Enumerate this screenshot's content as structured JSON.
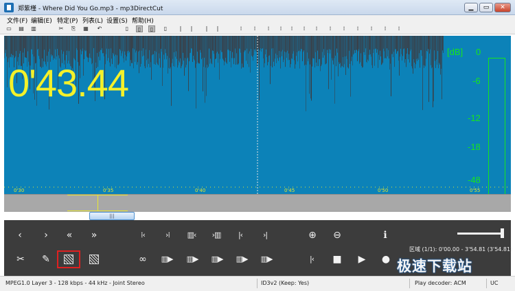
{
  "window": {
    "title": "郑紫槿 - Where Did You Go.mp3 - mp3DirectCut",
    "controls": [
      "▁",
      "▭",
      "✕"
    ]
  },
  "menu": [
    "文件(F)",
    "编辑(E)",
    "特定(P)",
    "列表(L)",
    "设置(S)",
    "帮助(H)"
  ],
  "toolbar": [
    {
      "icon": "open-icon",
      "glyph": "▭"
    },
    {
      "icon": "save-icon",
      "glyph": "▤"
    },
    {
      "icon": "save-all-icon",
      "glyph": "▥"
    },
    {
      "icon": "cut-icon",
      "glyph": "✂"
    },
    {
      "icon": "copy-icon",
      "glyph": "⎘"
    },
    {
      "icon": "paste-icon",
      "glyph": "▦"
    },
    {
      "icon": "undo-icon",
      "glyph": "↶"
    },
    {
      "icon": "doc-icon",
      "glyph": "▯"
    },
    {
      "icon": "doc-page-icon",
      "glyph": "▯"
    },
    {
      "icon": "doc-view-icon",
      "glyph": "▯"
    },
    {
      "icon": "doc-edit-icon",
      "glyph": "▯"
    },
    {
      "icon": "column-a-icon",
      "glyph": "|"
    },
    {
      "icon": "column-b-icon",
      "glyph": "|"
    },
    {
      "icon": "column-c-icon",
      "glyph": "|"
    },
    {
      "icon": "column-d-icon",
      "glyph": "|"
    },
    {
      "icon": "marker-a-icon",
      "glyph": "⁞"
    },
    {
      "icon": "marker-b-icon",
      "glyph": "⁞"
    },
    {
      "icon": "marker-c-icon",
      "glyph": "⁞"
    },
    {
      "icon": "marker-d-icon",
      "glyph": "⁞"
    },
    {
      "icon": "marker-e-icon",
      "glyph": "⁞"
    },
    {
      "icon": "marker-f-icon",
      "glyph": "⁞"
    },
    {
      "icon": "marker-g-icon",
      "glyph": "⁞"
    },
    {
      "icon": "marker-h-icon",
      "glyph": "⁞"
    },
    {
      "icon": "level-a-icon",
      "glyph": "⁞"
    },
    {
      "icon": "level-b-icon",
      "glyph": "⁞"
    },
    {
      "icon": "level-c-icon",
      "glyph": "⁞"
    },
    {
      "icon": "level-d-icon",
      "glyph": "⁞"
    },
    {
      "icon": "level-e-icon",
      "glyph": "⁞"
    }
  ],
  "waveform": {
    "time": "0'43.44",
    "db_unit": "[dB]",
    "db_scale": [
      "0",
      "-6",
      "-12",
      "-18",
      "-48"
    ],
    "ticks": [
      "0'30",
      "0'35",
      "0'40",
      "0'45",
      "0'50",
      "0'55"
    ],
    "colors": {
      "background": "#0c82b8",
      "wave": "#3a3f47",
      "time": "#f4f12a",
      "meter": "#17e61b"
    }
  },
  "scrollbar": {
    "thumb_label": "|||"
  },
  "controls": {
    "row1": [
      {
        "icon": "prev-icon",
        "glyph": "‹"
      },
      {
        "icon": "next-icon",
        "glyph": "›"
      },
      {
        "icon": "rewind-icon",
        "glyph": "«"
      },
      {
        "icon": "fast-forward-icon",
        "glyph": "»"
      },
      {
        "icon": "go-sel-start-icon",
        "glyph": "⁞‹"
      },
      {
        "icon": "go-sel-end-icon",
        "glyph": "›⁞"
      },
      {
        "icon": "sel-start-left-icon",
        "glyph": "▥‹"
      },
      {
        "icon": "sel-end-right-icon",
        "glyph": "›▥"
      },
      {
        "icon": "goto-start-icon",
        "glyph": "|‹"
      },
      {
        "icon": "goto-end-icon",
        "glyph": "›|"
      },
      {
        "icon": "zoom-in-icon",
        "glyph": "⊕"
      },
      {
        "icon": "zoom-out-icon",
        "glyph": "⊖"
      },
      {
        "icon": "info-icon",
        "glyph": "ℹ"
      }
    ],
    "row2": [
      {
        "icon": "scissors-icon",
        "glyph": "✂"
      },
      {
        "icon": "pencil-icon",
        "glyph": "✎"
      },
      {
        "icon": "select-icon",
        "glyph": ""
      },
      {
        "icon": "select-all-icon",
        "glyph": ""
      },
      {
        "icon": "loop-icon",
        "glyph": "∞"
      },
      {
        "icon": "play-selection-icon",
        "glyph": "▥▶"
      },
      {
        "icon": "play-sel-region-icon",
        "glyph": "▥▶"
      },
      {
        "icon": "play-from-start-icon",
        "glyph": "▥▶"
      },
      {
        "icon": "play-to-end-icon",
        "glyph": "▥▶"
      },
      {
        "icon": "play-last-icon",
        "glyph": "▥▶"
      },
      {
        "icon": "go-start-icon",
        "glyph": "|‹"
      },
      {
        "icon": "stop-icon",
        "glyph": "■"
      },
      {
        "icon": "play-icon",
        "glyph": "▶"
      },
      {
        "icon": "record-icon",
        "glyph": "●"
      }
    ],
    "region": "区域 (1/1): 0'00.00 - 3'54.81 (3'54.81)",
    "volume": 0.95
  },
  "watermark": "极速下载站",
  "status": {
    "format": "MPEG1.0 Layer 3 - 128 kbps - 44 kHz - Joint Stereo",
    "tag": "ID3v2 (Keep: Yes)",
    "decoder": "Play decoder: ACM",
    "extra": "UC"
  }
}
